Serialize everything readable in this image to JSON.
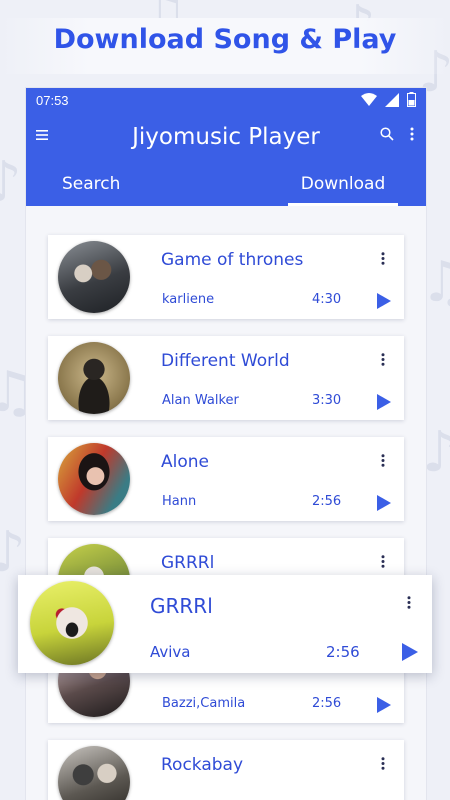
{
  "banner": {
    "title": "Download Song & Play"
  },
  "status": {
    "time": "07:53"
  },
  "app": {
    "title": "Jiyomusic Player"
  },
  "tabs": {
    "search": "Search",
    "download": "Download",
    "active": "Download"
  },
  "songs": [
    {
      "title": "Game of thrones",
      "artist": "karliene",
      "duration": "4:30"
    },
    {
      "title": "Different World",
      "artist": "Alan Walker",
      "duration": "3:30"
    },
    {
      "title": "Alone",
      "artist": "Hann",
      "duration": "2:56"
    },
    {
      "title": "GRRRl",
      "artist": "",
      "duration": ""
    },
    {
      "title": "",
      "artist": "Bazzi,Camila",
      "duration": "2:56"
    },
    {
      "title": "Rockabay",
      "artist": "",
      "duration": ""
    }
  ],
  "featured": {
    "title": "GRRRl",
    "artist": "Aviva",
    "duration": "2:56"
  },
  "colors": {
    "primary": "#3b5fe6",
    "accent_text": "#2f4bd6",
    "background": "#eef0f7"
  },
  "icons": {
    "menu": "menu-icon",
    "search": "search-icon",
    "more": "more-vertical-icon",
    "play": "play-icon",
    "wifi": "wifi-icon",
    "signal": "signal-icon",
    "battery": "battery-icon"
  }
}
